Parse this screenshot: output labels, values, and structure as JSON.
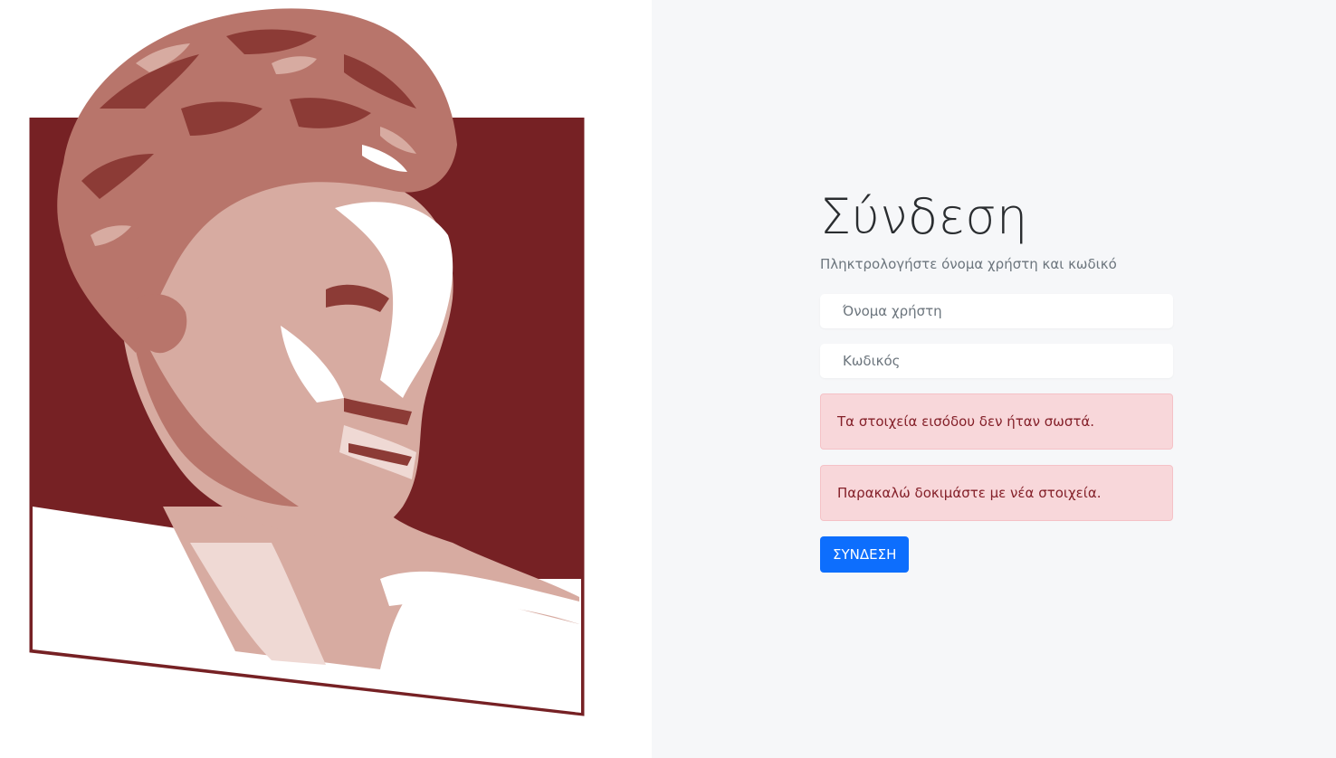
{
  "logo": {
    "name": "university-bust-logo",
    "colors": {
      "maroon": "#762124",
      "dark": "#8c3b36",
      "mid": "#b8756b",
      "light": "#d7aba1",
      "pale": "#efd9d4",
      "white": "#ffffff"
    }
  },
  "login": {
    "title": "Σύνδεση",
    "subtitle": "Πληκτρολογήστε όνομα χρήστη και κωδικό",
    "username_placeholder": "Όνομα χρήστη",
    "password_placeholder": "Κωδικός",
    "errors": [
      "Τα στοιχεία εισόδου δεν ήταν σωστά.",
      "Παρακαλώ δοκιμάστε με νέα στοιχεία."
    ],
    "submit_label": "ΣΥΝΔΕΣΗ"
  },
  "colors": {
    "right_bg": "#f6f7f9",
    "alert_bg": "#f8d7da",
    "alert_text": "#842029",
    "button_bg": "#0d6efd"
  }
}
